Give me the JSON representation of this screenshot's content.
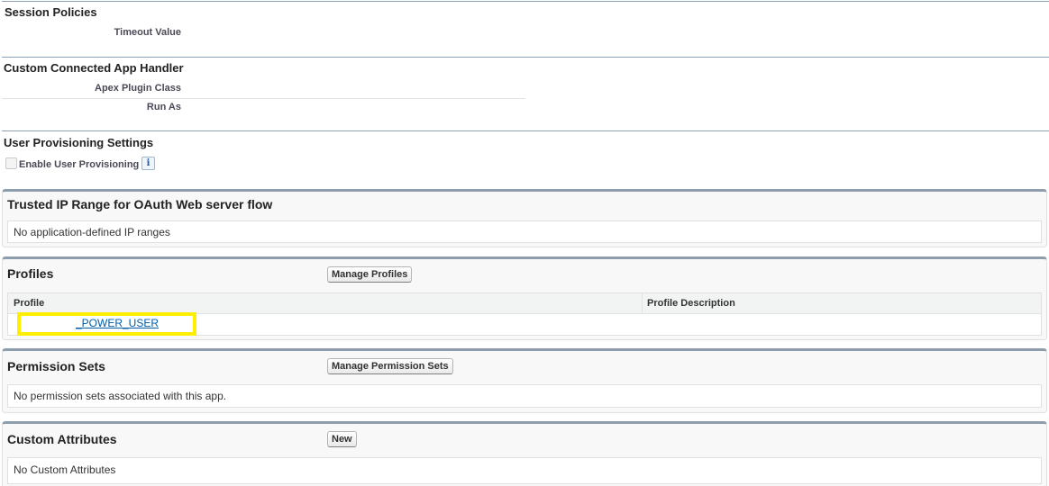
{
  "session_policies": {
    "title": "Session Policies",
    "timeout_value_label": "Timeout Value"
  },
  "custom_handler": {
    "title": "Custom Connected App Handler",
    "apex_plugin_class_label": "Apex Plugin Class",
    "run_as_label": "Run As"
  },
  "user_provisioning": {
    "title": "User Provisioning Settings",
    "enable_label": "Enable User Provisioning",
    "enable_checked": false,
    "info_icon_glyph": "i"
  },
  "trusted_ip": {
    "title": "Trusted IP Range for OAuth Web server flow",
    "empty_text": "No application-defined IP ranges"
  },
  "profiles": {
    "title": "Profiles",
    "manage_button": "Manage Profiles",
    "columns": [
      "Profile",
      "Profile Description"
    ],
    "rows": [
      {
        "profile": "_POWER_USER",
        "description": ""
      }
    ],
    "highlight_color": "#ffee00"
  },
  "permission_sets": {
    "title": "Permission Sets",
    "manage_button": "Manage Permission Sets",
    "empty_text": "No permission sets associated with this app."
  },
  "custom_attributes": {
    "title": "Custom Attributes",
    "new_button": "New",
    "empty_text": "No Custom Attributes"
  },
  "colors": {
    "section_rule": "#8aa1b9",
    "link": "#015ba7",
    "block_header_border": "#8e9dab"
  }
}
